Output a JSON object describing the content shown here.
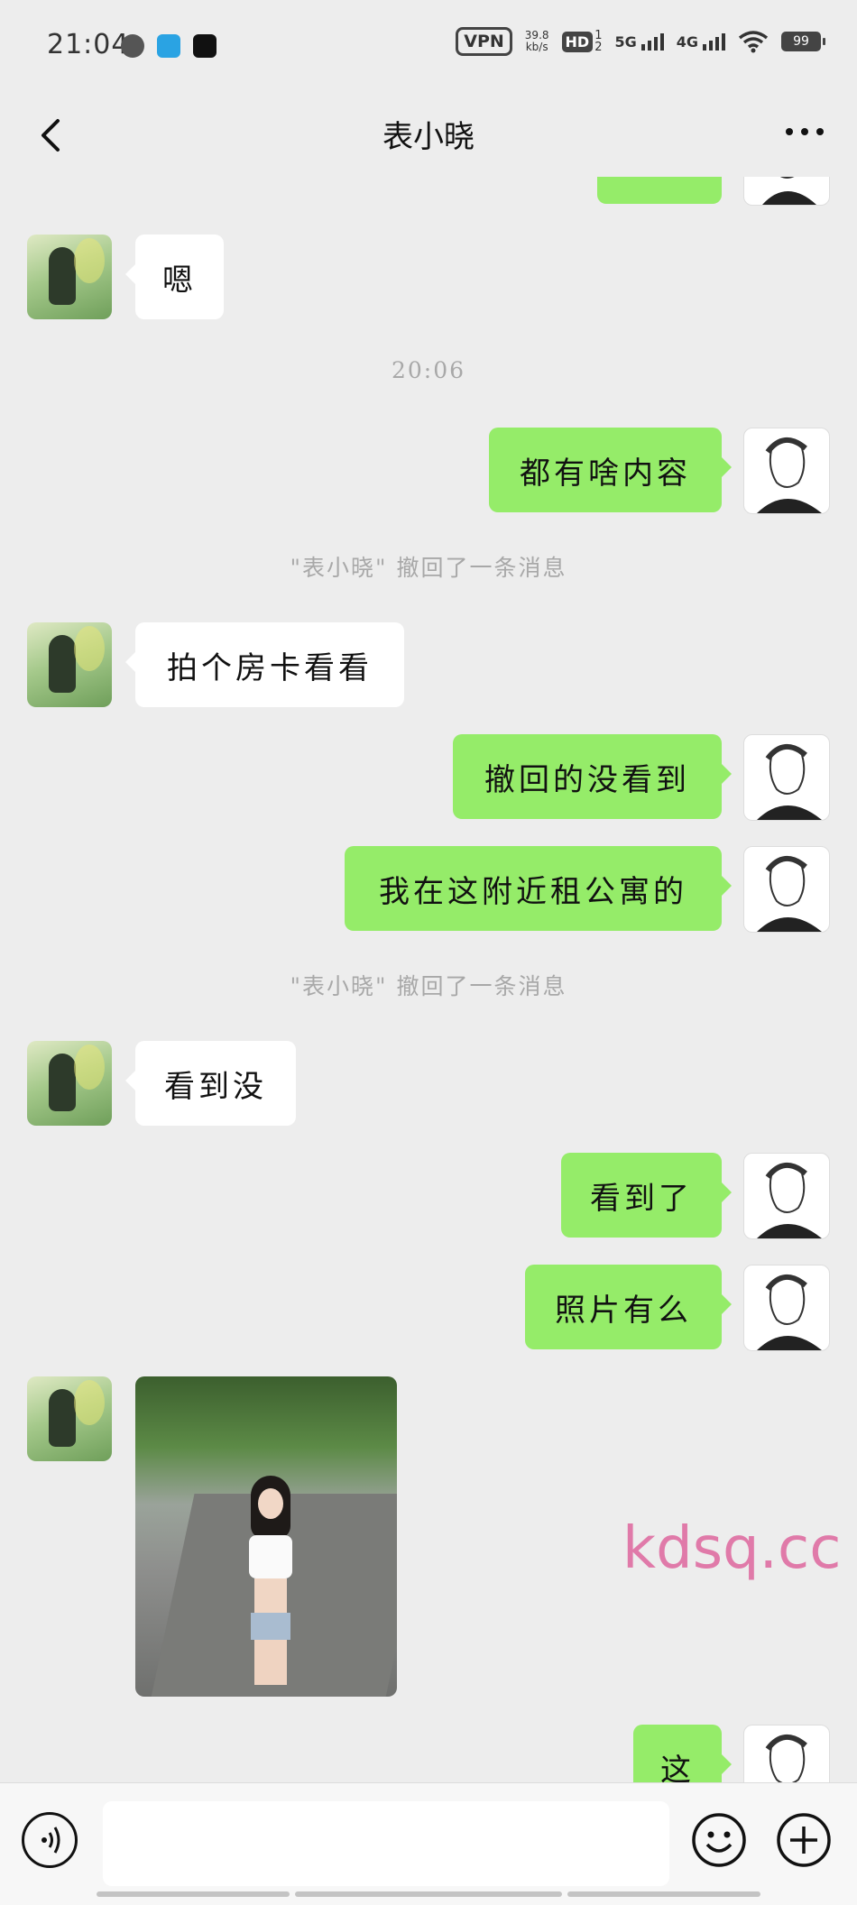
{
  "status_bar": {
    "time": "21:04",
    "vpn": "VPN",
    "net_speed_value": "39.8",
    "net_speed_unit": "kb/s",
    "hd": "HD",
    "hd_sub1": "1",
    "hd_sub2": "2",
    "sig1_label": "5G",
    "sig2_label": "4G",
    "battery": "99"
  },
  "header": {
    "title": "表小晓"
  },
  "messages": {
    "m1": "嗯",
    "time1": "20:06",
    "m2": "都有啥内容",
    "recall1": "\"表小晓\" 撤回了一条消息",
    "m3": "拍个房卡看看",
    "m4": "撤回的没看到",
    "m5": "我在这附近租公寓的",
    "recall2": "\"表小晓\" 撤回了一条消息",
    "m6": "看到没",
    "m7": "看到了",
    "m8": "照片有么",
    "m9": "这"
  },
  "watermark": "kdsq.cc",
  "input": {
    "placeholder": ""
  }
}
